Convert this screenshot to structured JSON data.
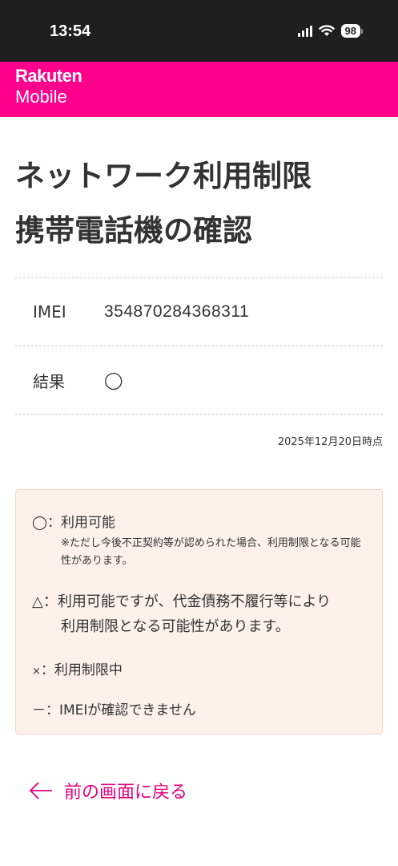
{
  "status_bar": {
    "time": "13:54",
    "battery": "98"
  },
  "brand": {
    "line1": "Rakuten",
    "line2": "Mobile",
    "color": "#ff008c"
  },
  "page": {
    "title_line1": "ネットワーク利用制限",
    "title_line2": "携帯電話機の確認"
  },
  "info": {
    "imei_label": "IMEI",
    "imei_value": "354870284368311",
    "result_label": "結果",
    "result_value": "◯"
  },
  "date_stamp": "2025年12月20日時点",
  "legend": {
    "ok_symbol": "◯",
    "ok_label": "：利用可能",
    "ok_note": "※ただし今後不正契約等が認められた場合、利用制限となる可能性があります。",
    "warn_symbol": "△",
    "warn_label_line1": "：利用可能ですが、代金債務不履行等により",
    "warn_label_line2": "利用制限となる可能性があります。",
    "ng_symbol": "×",
    "ng_label": "：利用制限中",
    "na_symbol": "－",
    "na_label": "：IMEIが確認できません"
  },
  "back_link": {
    "label": "前の画面に戻る",
    "icon": "arrow-left-icon",
    "color": "#e4007f"
  }
}
